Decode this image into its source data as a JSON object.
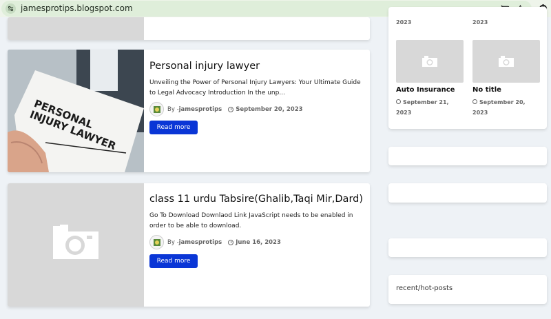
{
  "browser": {
    "url": "jamesprotips.blogspot.com"
  },
  "posts": [
    {
      "title": "Personal injury lawyer",
      "snippet": "Unveiling the Power of Personal Injury Lawyers: Your Ultimate Guide to Legal Advocacy   Introduction In the unp...",
      "author_prefix": "By - ",
      "author": "jamesprotips",
      "date": "September 20, 2023",
      "read_more": "Read more",
      "thumb_text": "PERSONAL INJURY LAWYER"
    },
    {
      "title": "class 11 urdu Tabsire(Ghalib,Taqi Mir,Dard)",
      "snippet": "Go To Download Downlaod Link JavaScript needs to be enabled in order to be able to download.",
      "author_prefix": "By - ",
      "author": "jamesprotips",
      "date": "June 16, 2023",
      "read_more": "Read more"
    }
  ],
  "sidebar": {
    "top_dates": [
      "2023",
      "2023"
    ],
    "mini_posts": [
      {
        "title": "Auto Insurance",
        "date_line1": "September 21,",
        "date_line2": "2023"
      },
      {
        "title": "No title",
        "date_line1": "September 20,",
        "date_line2": "2023"
      }
    ],
    "recent_label": "recent/hot-posts"
  },
  "colors": {
    "accent": "#0a36d6",
    "placeholder": "#d8d8d8",
    "background": "#eef2f6"
  }
}
